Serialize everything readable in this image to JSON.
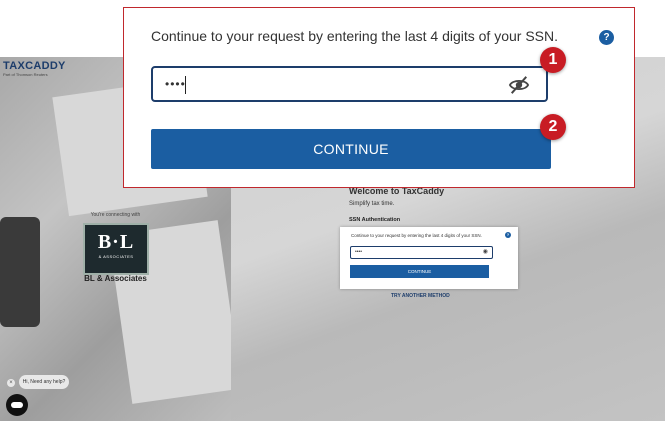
{
  "modal": {
    "prompt": "Continue to your request by entering the last 4 digits of your SSN.",
    "help_symbol": "?",
    "ssn_value": "••••",
    "ssn_placeholder": "",
    "eye_icon": "eye-slash-icon",
    "continue_label": "CONTINUE"
  },
  "callouts": [
    "1",
    "2"
  ],
  "background": {
    "logo": "TAXCADDY",
    "logo_sub": "Part of Thomson Reuters",
    "connecting": "You're connecting with",
    "firm_logo_mark": "B·L",
    "firm_logo_sub": "& ASSOCIATES",
    "firm_name": "BL & Associates",
    "welcome": "Welcome to TaxCaddy",
    "tagline": "Simplify tax time.",
    "section": "SSN Authentication",
    "mini_prompt": "Continue to your request by entering the last 4 digits of your SSN.",
    "mini_value": "••••",
    "mini_button": "CONTINUE",
    "try_another": "TRY ANOTHER METHOD",
    "chat_text": "Hi, Need any help?",
    "chat_close": "×"
  },
  "colors": {
    "primary": "#1b5ea2",
    "callout": "#c81c24",
    "highlight_border": "#c0282d"
  }
}
